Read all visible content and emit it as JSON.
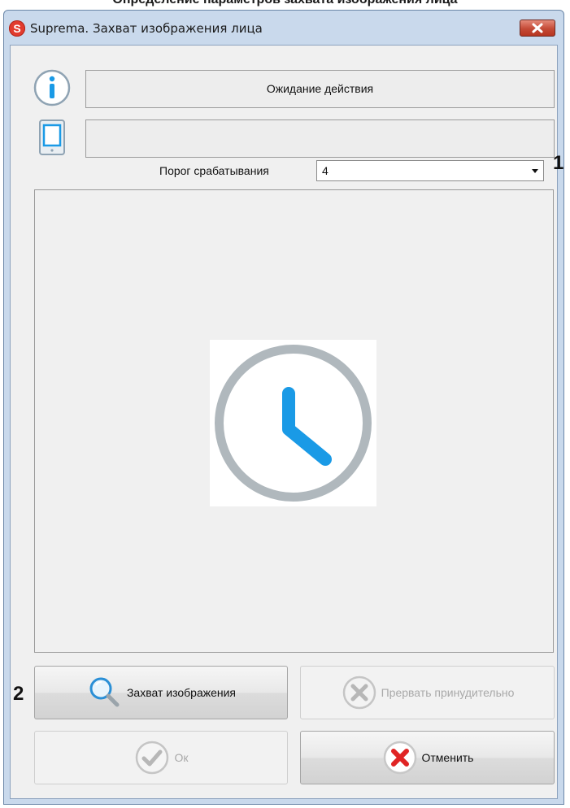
{
  "background": {
    "caption": "Определение параметров захвата изображения лица"
  },
  "window": {
    "title": "Suprema. Захват изображения лица",
    "app_icon_letter": "S",
    "close_icon": "close-icon"
  },
  "status": {
    "info_text": "Ожидание действия",
    "device_text": ""
  },
  "threshold": {
    "label": "Порог срабатывания",
    "value": "4"
  },
  "markers": {
    "m1": "1",
    "m2": "2"
  },
  "buttons": {
    "capture_label": "Захват изображения",
    "abort_label": "Прервать принудительно",
    "ok_label": "Ок",
    "cancel_label": "Отменить"
  },
  "colors": {
    "accent_blue": "#1a9ae6",
    "clock_ring": "#b0b8bd",
    "cancel_red": "#e02424"
  }
}
